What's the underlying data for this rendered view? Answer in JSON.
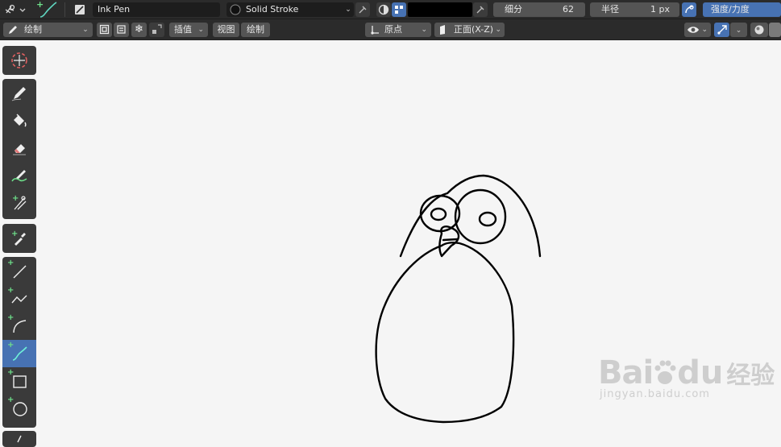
{
  "topbar": {
    "brush_name": "Ink Pen",
    "stroke_material": "Solid Stroke",
    "subdivide_label": "细分",
    "subdivide_value": "62",
    "radius_label": "半径",
    "radius_value": "1 px",
    "strength_label": "强度/力度",
    "color_swatch": "#000000"
  },
  "secbar": {
    "mode": "绘制",
    "interpolate": "插值",
    "view_menu": "视图",
    "draw_menu": "绘制",
    "origin": "原点",
    "orientation": "正面(X-Z)"
  },
  "toolbar": {
    "tools": [
      {
        "name": "cursor-tool"
      },
      {
        "name": "draw-tool"
      },
      {
        "name": "fill-tool"
      },
      {
        "name": "erase-tool"
      },
      {
        "name": "tint-tool"
      },
      {
        "name": "cutter-tool"
      },
      {
        "name": "eyedropper-tool"
      },
      {
        "name": "line-tool"
      },
      {
        "name": "polyline-tool"
      },
      {
        "name": "arc-tool"
      },
      {
        "name": "curve-tool",
        "active": true
      },
      {
        "name": "box-tool"
      },
      {
        "name": "circle-tool"
      }
    ]
  },
  "watermark": {
    "brand": "Bai",
    "brand2": "du",
    "brand_cn": "经验",
    "url": "jingyan.baidu.com"
  }
}
